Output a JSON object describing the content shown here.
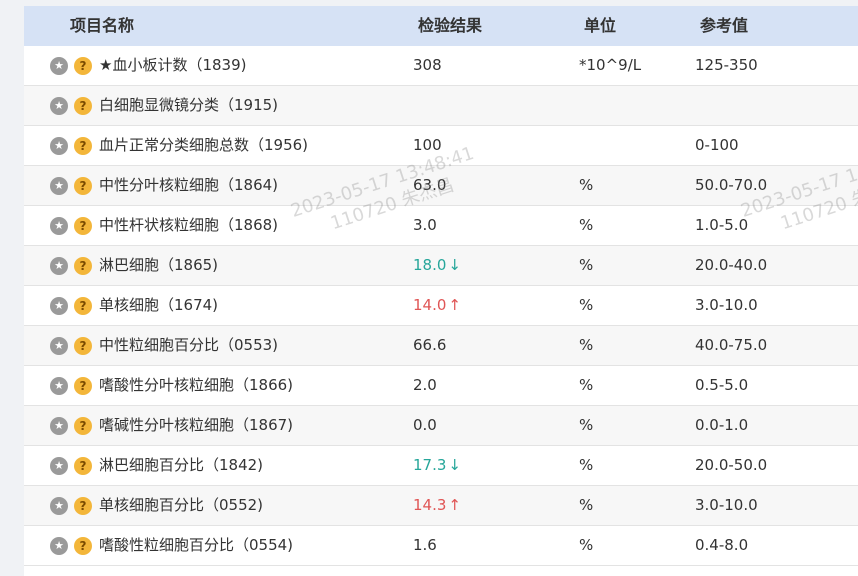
{
  "header": {
    "name": "项目名称",
    "result": "检验结果",
    "unit": "单位",
    "ref": "参考值"
  },
  "icons": {
    "star": "star-icon",
    "help": "help-icon"
  },
  "colors": {
    "low": "#26a69a",
    "high": "#e05555",
    "header_bg": "#d6e2f5"
  },
  "rows": [
    {
      "name": "★血小板计数（1839)",
      "result": "308",
      "flag": "",
      "unit": "*10^9/L",
      "ref": "125-350"
    },
    {
      "name": "白细胞显微镜分类（1915)",
      "result": "",
      "flag": "",
      "unit": "",
      "ref": ""
    },
    {
      "name": "血片正常分类细胞总数（1956)",
      "result": "100",
      "flag": "",
      "unit": "",
      "ref": "0-100"
    },
    {
      "name": "中性分叶核粒细胞（1864)",
      "result": "63.0",
      "flag": "",
      "unit": "%",
      "ref": "50.0-70.0"
    },
    {
      "name": "中性杆状核粒细胞（1868)",
      "result": "3.0",
      "flag": "",
      "unit": "%",
      "ref": "1.0-5.0"
    },
    {
      "name": "淋巴细胞（1865)",
      "result": "18.0",
      "flag": "low",
      "arrow": "↓",
      "unit": "%",
      "ref": "20.0-40.0"
    },
    {
      "name": "单核细胞（1674)",
      "result": "14.0",
      "flag": "high",
      "arrow": "↑",
      "unit": "%",
      "ref": "3.0-10.0"
    },
    {
      "name": "中性粒细胞百分比（0553)",
      "result": "66.6",
      "flag": "",
      "unit": "%",
      "ref": "40.0-75.0"
    },
    {
      "name": "嗜酸性分叶核粒细胞（1866)",
      "result": "2.0",
      "flag": "",
      "unit": "%",
      "ref": "0.5-5.0"
    },
    {
      "name": "嗜碱性分叶核粒细胞（1867)",
      "result": "0.0",
      "flag": "",
      "unit": "%",
      "ref": "0.0-1.0"
    },
    {
      "name": "淋巴细胞百分比（1842)",
      "result": "17.3",
      "flag": "low",
      "arrow": "↓",
      "unit": "%",
      "ref": "20.0-50.0"
    },
    {
      "name": "单核细胞百分比（0552)",
      "result": "14.3",
      "flag": "high",
      "arrow": "↑",
      "unit": "%",
      "ref": "3.0-10.0"
    },
    {
      "name": "嗜酸性粒细胞百分比（0554)",
      "result": "1.6",
      "flag": "",
      "unit": "%",
      "ref": "0.4-8.0"
    }
  ],
  "watermarks": [
    {
      "line1": "2023-05-17 13:48:41",
      "line2": "110720 朱杰昌"
    },
    {
      "line1": "2023-05-17 1",
      "line2": "110720 朱"
    }
  ]
}
